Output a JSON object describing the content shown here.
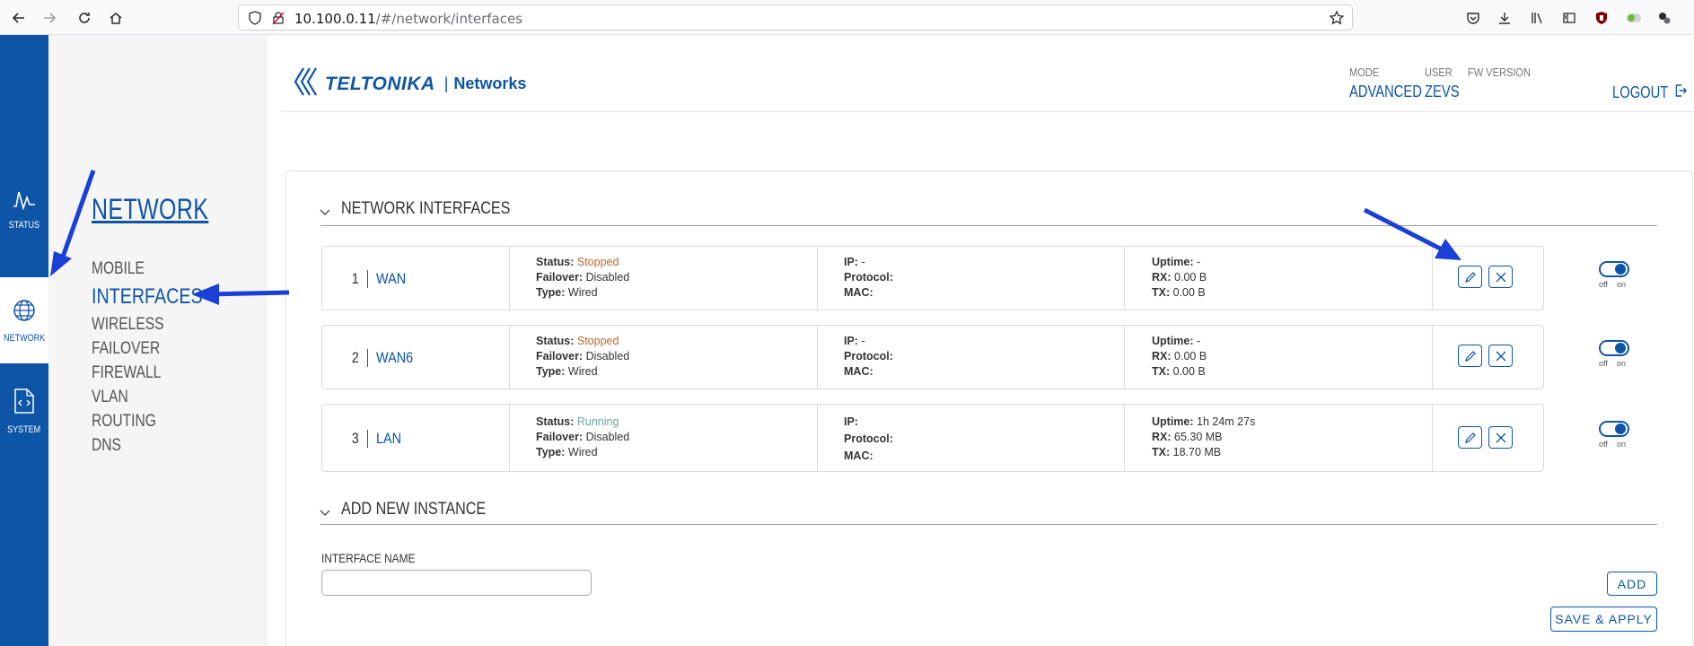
{
  "browser": {
    "url_host": "10.100.0.11",
    "url_path": "/#/network/interfaces"
  },
  "rail": [
    {
      "label": "STATUS",
      "icon": "activity-icon"
    },
    {
      "label": "NETWORK",
      "icon": "globe-icon"
    },
    {
      "label": "SYSTEM",
      "icon": "file-code-icon"
    }
  ],
  "subnav": {
    "title": "NETWORK",
    "items": [
      "MOBILE",
      "INTERFACES",
      "WIRELESS",
      "FAILOVER",
      "FIREWALL",
      "VLAN",
      "ROUTING",
      "DNS"
    ]
  },
  "header": {
    "logo": "TELTONIKA",
    "logo_sub": "Networks",
    "mode_label": "MODE",
    "mode_value": "ADVANCED",
    "user_label": "USER",
    "user_value": "ZEVS",
    "fw_label": "FW VERSION",
    "logout": "LOGOUT"
  },
  "interfaces_section": {
    "title": "NETWORK INTERFACES",
    "rows": [
      {
        "num": "1",
        "name": "WAN",
        "status": "Stopped",
        "failover": "Disabled",
        "type": "Wired",
        "ip": "-",
        "protocol": "",
        "mac": "",
        "uptime": "-",
        "rx": "0.00 B",
        "tx": "0.00 B"
      },
      {
        "num": "2",
        "name": "WAN6",
        "status": "Stopped",
        "failover": "Disabled",
        "type": "Wired",
        "ip": "-",
        "protocol": "",
        "mac": "",
        "uptime": "-",
        "rx": "0.00 B",
        "tx": "0.00 B"
      },
      {
        "num": "3",
        "name": "LAN",
        "status": "Running",
        "failover": "Disabled",
        "type": "Wired",
        "ip": "",
        "protocol": "",
        "mac": "",
        "uptime": "1h 24m 27s",
        "rx": "65.30 MB",
        "tx": "18.70 MB"
      }
    ],
    "labels": {
      "status": "Status:",
      "failover": "Failover:",
      "type": "Type:",
      "ip": "IP:",
      "protocol": "Protocol:",
      "mac": "MAC:",
      "uptime": "Uptime:",
      "rx": "RX:",
      "tx": "TX:",
      "off": "off",
      "on": "on"
    }
  },
  "add_section": {
    "title": "ADD NEW INSTANCE",
    "field_label": "INTERFACE NAME",
    "field_value": "",
    "add_button": "ADD",
    "save_button": "SAVE & APPLY"
  },
  "colors": {
    "brand": "#0e55a7",
    "stopped": "#c0672a",
    "running": "#6aa59e",
    "annotation_arrow": "#1a3fd6"
  }
}
